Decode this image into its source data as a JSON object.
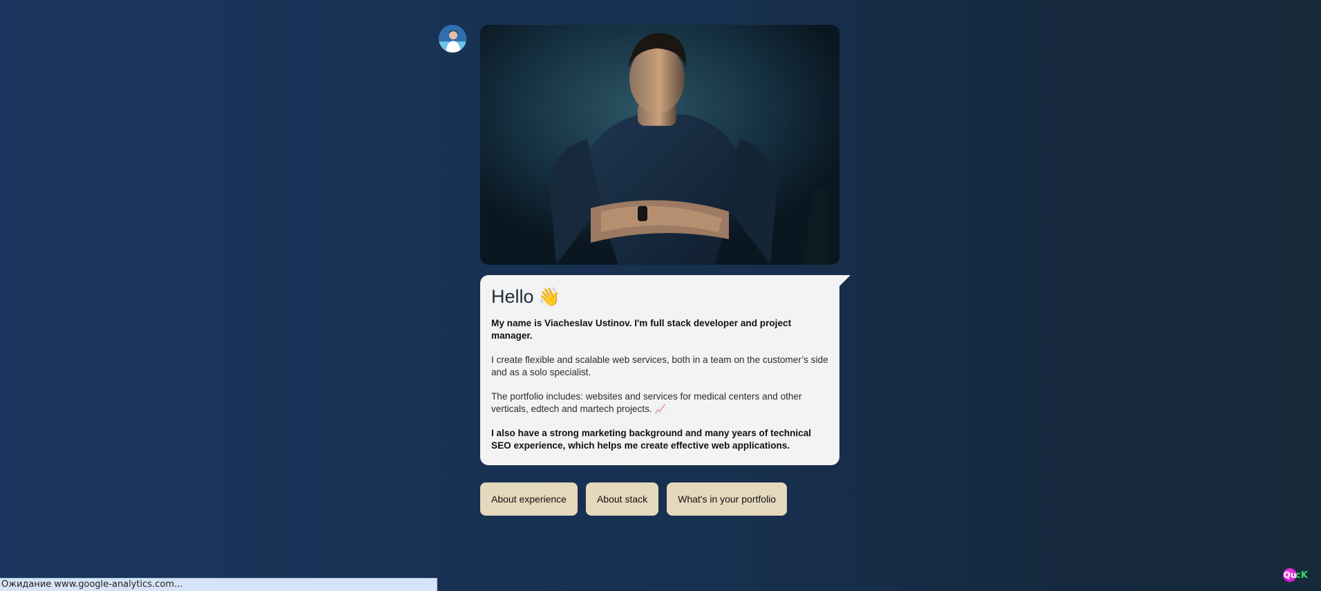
{
  "profile": {
    "avatar_icon": "user-avatar-icon",
    "photo_icon": "portrait-photo"
  },
  "message": {
    "greeting": "Hello",
    "greeting_emoji": "👋",
    "intro": "My name is Viacheslav Ustinov. I'm full stack developer and project manager.",
    "paragraph1": "I create flexible and scalable web services, both in a team on the customer’s side and as a solo specialist.",
    "paragraph2": "The portfolio includes: websites and services for medical centers and other verticals, edtech and martech projects.",
    "paragraph2_emoji": "📈",
    "paragraph3": "I also have a strong marketing background and many years of technical SEO experience, which helps me create effective web applications."
  },
  "actions": {
    "experience": "About experience",
    "stack": "About stack",
    "portfolio": "What's in your portfolio"
  },
  "status_bar": {
    "text": "Ожидание www.google-analytics.com..."
  },
  "quick_logo": {
    "first": "Qu",
    "rest": "cK"
  },
  "colors": {
    "background": "#1b365e",
    "bubble": "#f3f3f3",
    "button": "#e5d8bd"
  }
}
